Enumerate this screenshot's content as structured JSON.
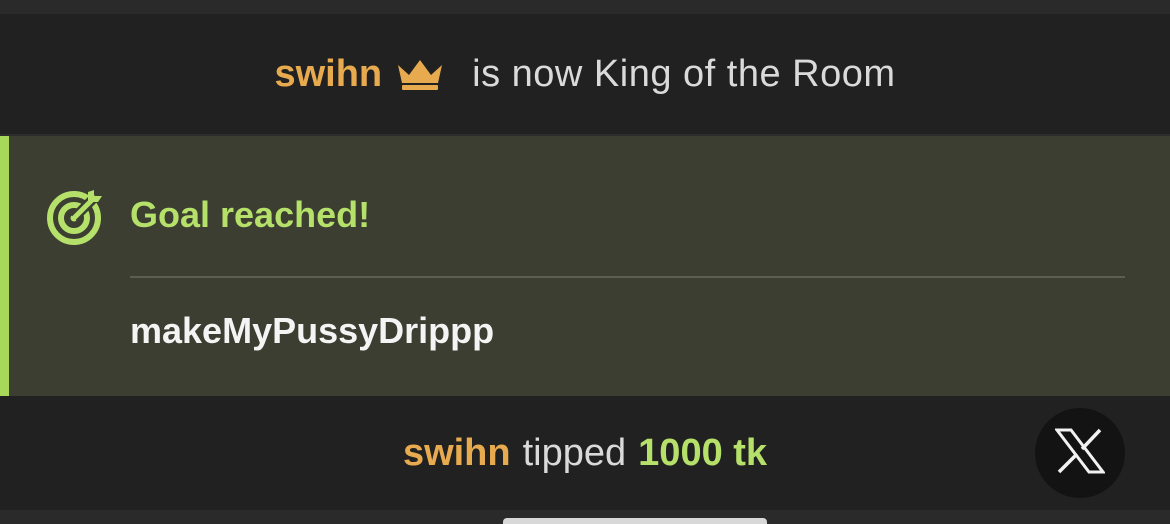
{
  "king_banner": {
    "username": "swihn",
    "icon": "crown-icon",
    "message": "is now King of the Room"
  },
  "goal": {
    "icon": "target-icon",
    "title": "Goal reached!",
    "name": "makeMyPussyDrippp"
  },
  "tip": {
    "username": "swihn",
    "verb": "tipped",
    "amount": "1000 tk"
  },
  "x_logo_button": {
    "icon": "x-logo-icon"
  },
  "colors": {
    "username": "#e8aa4f",
    "goal_green": "#b5e06a",
    "accent_bar": "#a8d85a",
    "goal_bg": "#3b3e31",
    "page_bg": "#212121"
  }
}
